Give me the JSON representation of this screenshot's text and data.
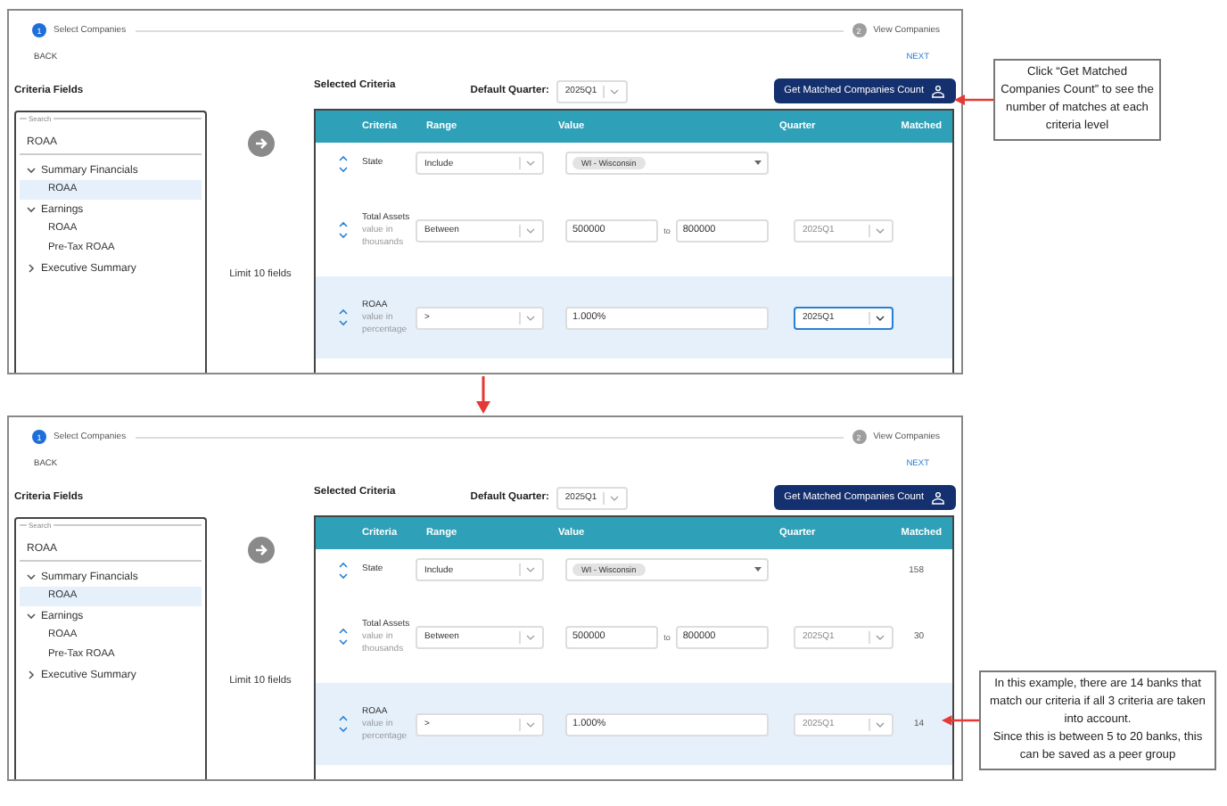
{
  "screens": [
    {
      "steps": [
        {
          "number": "1",
          "label": "Select Companies",
          "selected": true
        },
        {
          "number": "2",
          "label": "View Companies",
          "selected": false
        }
      ],
      "back": "BACK",
      "next": "NEXT",
      "fields_title": "Criteria Fields",
      "search": {
        "label": "Search",
        "value": "ROAA"
      },
      "tree": [
        {
          "label": "Summary Financials",
          "expanded": true,
          "children": [
            {
              "label": "ROAA",
              "selected": true
            }
          ]
        },
        {
          "label": "Earnings",
          "expanded": true,
          "children": [
            {
              "label": "ROAA",
              "selected": false
            },
            {
              "label": "Pre-Tax ROAA",
              "selected": false
            }
          ]
        },
        {
          "label": "Executive Summary",
          "expanded": false
        }
      ],
      "limit_note": "Limit 10 fields",
      "selected_title": "Selected Criteria",
      "default_quarter": {
        "label": "Default Quarter:",
        "value": "2025Q1"
      },
      "match_button": "Get Matched Companies Count",
      "columns": [
        "Criteria",
        "Range",
        "Value",
        "Quarter",
        "Matched"
      ],
      "rows": [
        {
          "kind": "chip",
          "name": "State",
          "range": "Include",
          "chip": "WI - Wisconsin",
          "selected": false
        },
        {
          "kind": "between",
          "name": "Total Assets",
          "hint": "value in thousands",
          "range": "Between",
          "from": "500000",
          "joiner": "to",
          "to": "800000",
          "quarter": "2025Q1",
          "quarter_focused": false,
          "selected": false
        },
        {
          "kind": "single",
          "name": "ROAA",
          "hint": "value in percentage",
          "range": ">",
          "value": "1.000%",
          "quarter": "2025Q1",
          "quarter_focused": true,
          "selected": true
        }
      ],
      "callout": {
        "kind": "button",
        "paragraphs": [
          "Click “Get Matched Companies Count” to see the number of matches at each criteria level"
        ]
      }
    },
    {
      "steps": [
        {
          "number": "1",
          "label": "Select Companies",
          "selected": true
        },
        {
          "number": "2",
          "label": "View Companies",
          "selected": false
        }
      ],
      "back": "BACK",
      "next": "NEXT",
      "fields_title": "Criteria Fields",
      "search": {
        "label": "Search",
        "value": "ROAA"
      },
      "tree": [
        {
          "label": "Summary Financials",
          "expanded": true,
          "children": [
            {
              "label": "ROAA",
              "selected": true
            }
          ]
        },
        {
          "label": "Earnings",
          "expanded": true,
          "children": [
            {
              "label": "ROAA",
              "selected": false
            },
            {
              "label": "Pre-Tax ROAA",
              "selected": false
            }
          ]
        },
        {
          "label": "Executive Summary",
          "expanded": false
        }
      ],
      "limit_note": "Limit 10 fields",
      "selected_title": "Selected Criteria",
      "default_quarter": {
        "label": "Default Quarter:",
        "value": "2025Q1"
      },
      "match_button": "Get Matched Companies Count",
      "columns": [
        "Criteria",
        "Range",
        "Value",
        "Quarter",
        "Matched"
      ],
      "rows": [
        {
          "kind": "chip",
          "name": "State",
          "range": "Include",
          "chip": "WI - Wisconsin",
          "matched": "158",
          "selected": false
        },
        {
          "kind": "between",
          "name": "Total Assets",
          "hint": "value in thousands",
          "range": "Between",
          "from": "500000",
          "joiner": "to",
          "to": "800000",
          "quarter": "2025Q1",
          "quarter_focused": false,
          "matched": "30",
          "selected": false
        },
        {
          "kind": "single",
          "name": "ROAA",
          "hint": "value in percentage",
          "range": ">",
          "value": "1.000%",
          "quarter": "2025Q1",
          "quarter_focused": false,
          "matched": "14",
          "selected": true
        }
      ],
      "callout": {
        "kind": "matched",
        "paragraphs": [
          "In this example, there are 14 banks that match our criteria if all 3 criteria are taken into account.",
          "Since this is between 5 to 20 banks, this can be saved as a peer group"
        ]
      }
    }
  ]
}
